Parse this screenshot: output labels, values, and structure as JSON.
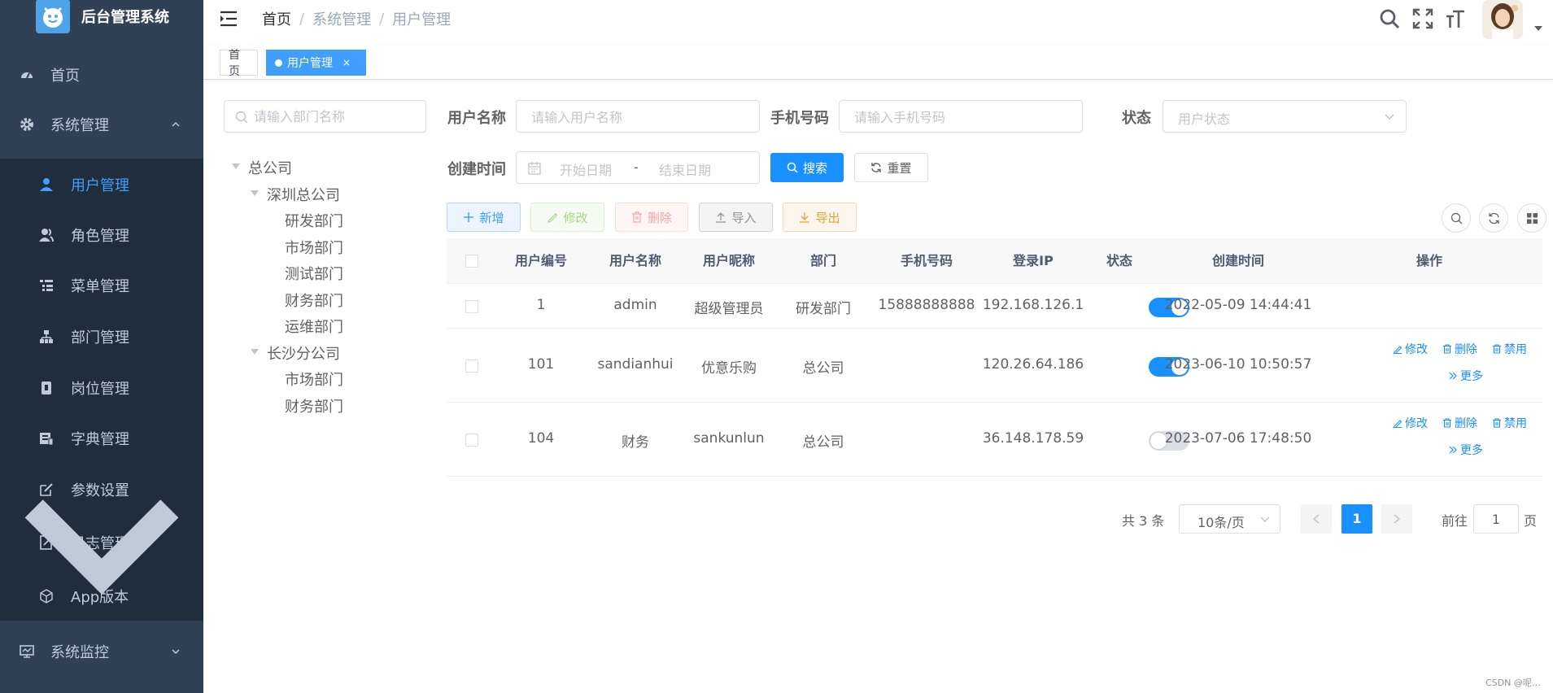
{
  "app": {
    "title": "后台管理系统"
  },
  "sidebar": {
    "items": [
      {
        "label": "首页",
        "icon": "dashboard-icon"
      },
      {
        "label": "系统管理",
        "icon": "gear-icon"
      },
      {
        "label": "系统监控",
        "icon": "monitor-icon"
      }
    ],
    "submenu": [
      {
        "label": "用户管理",
        "icon": "user-icon",
        "active": true
      },
      {
        "label": "角色管理",
        "icon": "peoples-icon"
      },
      {
        "label": "菜单管理",
        "icon": "tree-table-icon"
      },
      {
        "label": "部门管理",
        "icon": "tree-icon"
      },
      {
        "label": "岗位管理",
        "icon": "post-icon"
      },
      {
        "label": "字典管理",
        "icon": "dict-icon"
      },
      {
        "label": "参数设置",
        "icon": "edit-icon"
      },
      {
        "label": "日志管理",
        "icon": "log-icon"
      },
      {
        "label": "App版本",
        "icon": "box-icon"
      }
    ]
  },
  "breadcrumb": [
    "首页",
    "系统管理",
    "用户管理"
  ],
  "tags": [
    {
      "label": "首页",
      "active": false
    },
    {
      "label": "用户管理",
      "active": true,
      "close": "×"
    }
  ],
  "dept": {
    "search_placeholder": "请输入部门名称",
    "tree": [
      {
        "label": "总公司"
      },
      {
        "label": "深圳总公司"
      },
      {
        "label": "研发部门"
      },
      {
        "label": "市场部门"
      },
      {
        "label": "测试部门"
      },
      {
        "label": "财务部门"
      },
      {
        "label": "运维部门"
      },
      {
        "label": "长沙分公司"
      },
      {
        "label": "市场部门"
      },
      {
        "label": "财务部门"
      }
    ]
  },
  "filters": {
    "username_label": "用户名称",
    "username_placeholder": "请输入用户名称",
    "phone_label": "手机号码",
    "phone_placeholder": "请输入手机号码",
    "status_label": "状态",
    "status_placeholder": "用户状态",
    "created_label": "创建时间",
    "start_placeholder": "开始日期",
    "range_sep": "-",
    "end_placeholder": "结束日期",
    "search_btn": "搜索",
    "reset_btn": "重置"
  },
  "toolbar": {
    "add": "新增",
    "edit": "修改",
    "delete": "删除",
    "import": "导入",
    "export": "导出"
  },
  "table": {
    "headers": [
      "用户编号",
      "用户名称",
      "用户昵称",
      "部门",
      "手机号码",
      "登录IP",
      "状态",
      "创建时间",
      "操作"
    ],
    "rows": [
      {
        "id": "1",
        "username": "admin",
        "nickname": "超级管理员",
        "dept": "研发部门",
        "phone": "15888888888",
        "ip": "192.168.126.1",
        "status": true,
        "created": "2022-05-09 14:44:41"
      },
      {
        "id": "101",
        "username": "sandianhui",
        "nickname": "优意乐购",
        "dept": "总公司",
        "phone": "",
        "ip": "120.26.64.186",
        "status": true,
        "created": "2023-06-10 10:50:57"
      },
      {
        "id": "104",
        "username": "财务",
        "nickname": "sankunlun",
        "dept": "总公司",
        "phone": "",
        "ip": "36.148.178.59",
        "status": false,
        "created": "2023-07-06 17:48:50"
      }
    ],
    "ops": {
      "edit": "修改",
      "delete": "删除",
      "disable": "禁用",
      "more": "更多"
    }
  },
  "pagination": {
    "total_text": "共 3 条",
    "page_size": "10条/页",
    "current_page": "1",
    "goto_label": "前往",
    "goto_value": "1",
    "page_suffix": "页"
  },
  "watermark": "CSDN @呢…",
  "colors": {
    "sidebar_bg": "#304156",
    "submenu_bg": "#1f2d3d",
    "primary": "#1890ff",
    "active_menu": "#409eff"
  }
}
